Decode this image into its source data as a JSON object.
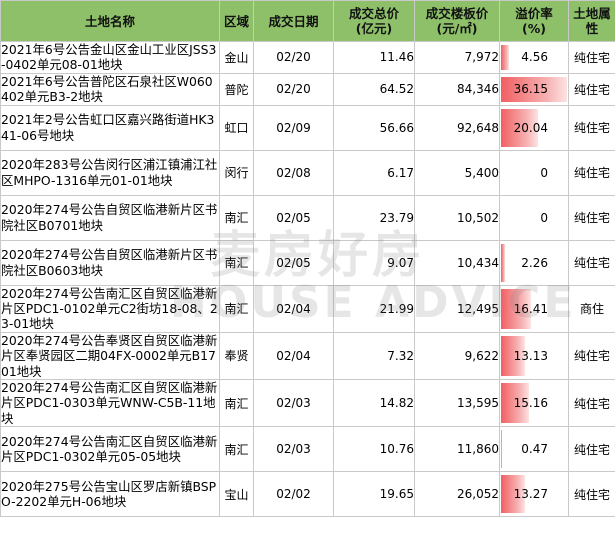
{
  "headers": [
    "土地名称",
    "区域",
    "成交日期",
    "成交总价\n(亿元)",
    "成交楼板价\n(元/㎡)",
    "溢价率\n(%)",
    "土地属性"
  ],
  "rows": [
    {
      "name": "2021年6号公告金山区金山工业区JSS3-0402单元08-01地块",
      "district": "金山",
      "date": "02/20",
      "total": "11.46",
      "floor_price": "7,972",
      "premium": "4.56",
      "premium_value": 4.56,
      "property": "纯住宅"
    },
    {
      "name": "2021年6号公告普陀区石泉社区W060402单元B3-2地块",
      "district": "普陀",
      "date": "02/20",
      "total": "64.52",
      "floor_price": "84,346",
      "premium": "36.15",
      "premium_value": 36.15,
      "property": "纯住宅"
    },
    {
      "name": "2021年2号公告虹口区嘉兴路街道HK341-06号地块",
      "district": "虹口",
      "date": "02/09",
      "total": "56.66",
      "floor_price": "92,648",
      "premium": "20.04",
      "premium_value": 20.04,
      "property": "纯住宅"
    },
    {
      "name": "2020年283号公告闵行区浦江镇浦江社区MHPO-1316单元01-01地块",
      "district": "闵行",
      "date": "02/08",
      "total": "6.17",
      "floor_price": "5,400",
      "premium": "0",
      "premium_value": 0,
      "property": "纯住宅"
    },
    {
      "name": "2020年274号公告自贸区临港新片区书院社区B0701地块",
      "district": "南汇",
      "date": "02/05",
      "total": "23.79",
      "floor_price": "10,502",
      "premium": "0",
      "premium_value": 0,
      "property": "纯住宅"
    },
    {
      "name": "2020年274号公告自贸区临港新片区书院社区B0603地块",
      "district": "南汇",
      "date": "02/05",
      "total": "9.07",
      "floor_price": "10,434",
      "premium": "2.26",
      "premium_value": 2.26,
      "property": "纯住宅"
    },
    {
      "name": "2020年274号公告南汇区自贸区临港新片区PDC1-0102单元C2街坊18-08、23-01地块",
      "district": "南汇",
      "date": "02/04",
      "total": "21.99",
      "floor_price": "12,495",
      "premium": "16.41",
      "premium_value": 16.41,
      "property": "商住"
    },
    {
      "name": "2020年274号公告奉贤区自贸区临港新片区奉贤园区二期04FX-0002单元B1701地块",
      "district": "奉贤",
      "date": "02/04",
      "total": "7.32",
      "floor_price": "9,622",
      "premium": "13.13",
      "premium_value": 13.13,
      "property": "纯住宅"
    },
    {
      "name": "2020年274号公告南汇区自贸区临港新片区PDC1-0303单元WNW-C5B-11地块",
      "district": "南汇",
      "date": "02/03",
      "total": "14.82",
      "floor_price": "13,595",
      "premium": "15.16",
      "premium_value": 15.16,
      "property": "纯住宅"
    },
    {
      "name": "2020年274号公告南汇区自贸区临港新片区PDC1-0302单元05-05地块",
      "district": "南汇",
      "date": "02/03",
      "total": "10.76",
      "floor_price": "11,860",
      "premium": "0.47",
      "premium_value": 0.47,
      "property": "纯住宅"
    },
    {
      "name": "2020年275号公告宝山区罗店新镇BSPO-2202单元H-06地块",
      "district": "宝山",
      "date": "02/02",
      "total": "19.65",
      "floor_price": "26,052",
      "premium": "13.27",
      "premium_value": 13.27,
      "property": "纯住宅"
    }
  ],
  "premium_scale_max": 36.15,
  "watermark": {
    "cn": "麦房好房",
    "en": "HOUSE ADVICE"
  },
  "colors": {
    "header_bg": "#8ec06a",
    "bar": "#f05f62",
    "grid": "#c9c9c9"
  }
}
